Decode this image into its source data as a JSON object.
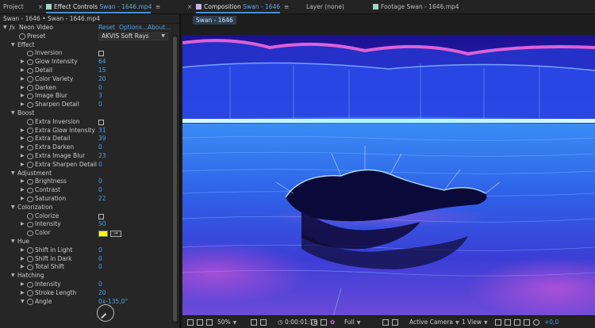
{
  "topbar": {
    "project_tab": "Project",
    "effect_controls_prefix": "Effect Controls",
    "effect_controls_file": "Swan - 1646.mp4",
    "composition_prefix": "Composition",
    "composition_name": "Swan - 1646",
    "layer_tab": "Layer (none)",
    "footage_prefix": "Footage",
    "footage_file": "Swan - 1646.mp4",
    "close_glyph": "×",
    "menu_glyph": "≡"
  },
  "effect_controls": {
    "header": "Swan - 1646 • Swan - 1646.mp4",
    "effect_name": "Neon Video",
    "links": {
      "reset": "Reset",
      "options": "Options...",
      "about": "About..."
    },
    "preset_label": "Preset",
    "preset_value": "AKVIS Soft Rays",
    "groups": {
      "effect": {
        "label": "Effect",
        "inversion": "Inversion",
        "glow_intensity": {
          "label": "Glow Intensity",
          "value": "64"
        },
        "detail": {
          "label": "Detail",
          "value": "15"
        },
        "color_variety": {
          "label": "Color Variety",
          "value": "20"
        },
        "darken": {
          "label": "Darken",
          "value": "0"
        },
        "image_blur": {
          "label": "Image Blur",
          "value": "3"
        },
        "sharpen_detail": {
          "label": "Sharpen Detail",
          "value": "0"
        }
      },
      "boost": {
        "label": "Boost",
        "extra_inversion": "Extra Inversion",
        "extra_glow_intensity": {
          "label": "Extra Glow Intensity",
          "value": "31"
        },
        "extra_detail": {
          "label": "Extra Detail",
          "value": "39"
        },
        "extra_darken": {
          "label": "Extra Darken",
          "value": "0"
        },
        "extra_image_blur": {
          "label": "Extra Image Blur",
          "value": "23"
        },
        "extra_sharpen_detail": {
          "label": "Extra Sharpen Detail",
          "value": "0"
        }
      },
      "adjustment": {
        "label": "Adjustment",
        "brightness": {
          "label": "Brightness",
          "value": "0"
        },
        "contrast": {
          "label": "Contrast",
          "value": "0"
        },
        "saturation": {
          "label": "Saturation",
          "value": "22"
        }
      },
      "colorization": {
        "label": "Colorization",
        "colorize": "Colorize",
        "intensity": {
          "label": "Intensity",
          "value": "50"
        },
        "color": {
          "label": "Color",
          "hex": "#ffff00"
        }
      },
      "hue": {
        "label": "Hue",
        "shift_in_light": {
          "label": "Shift in Light",
          "value": "0"
        },
        "shift_in_dark": {
          "label": "Shift in Dark",
          "value": "0"
        },
        "total_shift": {
          "label": "Total Shift",
          "value": "0"
        }
      },
      "hatching": {
        "label": "Hatching",
        "intensity": {
          "label": "Intensity",
          "value": "0"
        },
        "stroke_length": {
          "label": "Stroke Length",
          "value": "20"
        },
        "angle": {
          "label": "Angle",
          "value": "0x-135,0°"
        }
      }
    }
  },
  "composition": {
    "subtab": "Swan - 1646",
    "viewer_bar": {
      "zoom": "50%",
      "timecode": "0:00:01:16",
      "resolution": "Full",
      "camera": "Active Camera",
      "views": "1 View",
      "exposure": "+0,0"
    }
  }
}
